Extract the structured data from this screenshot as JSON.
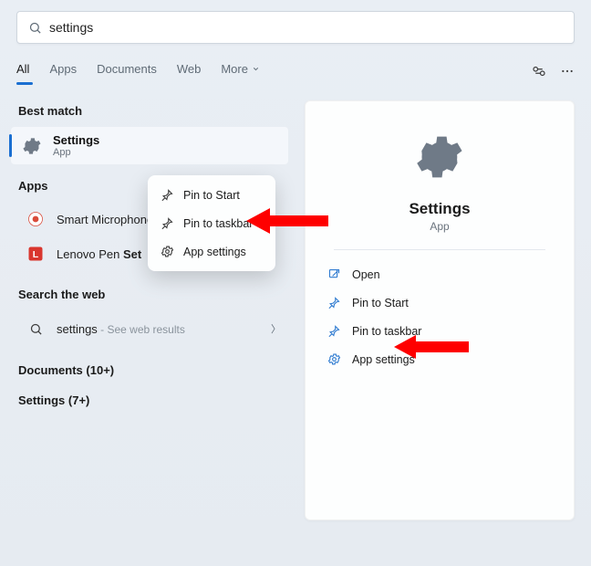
{
  "search": {
    "query": "settings"
  },
  "tabs": {
    "all": "All",
    "apps": "Apps",
    "documents": "Documents",
    "web": "Web",
    "more": "More"
  },
  "sections": {
    "best_match": "Best match",
    "apps": "Apps",
    "search_web": "Search the web",
    "documents_count": "Documents (10+)",
    "settings_count": "Settings (7+)"
  },
  "best_match": {
    "name": "Settings",
    "type": "App"
  },
  "apps_results": {
    "item1": "Smart Microphone",
    "item2_prefix": "Lenovo Pen ",
    "item2_bold": "Set"
  },
  "web_result": {
    "term": "settings",
    "hint": " - See web results"
  },
  "context_menu": {
    "pin_start": "Pin to Start",
    "pin_taskbar": "Pin to taskbar",
    "app_settings": "App settings"
  },
  "detail": {
    "title": "Settings",
    "sub": "App"
  },
  "actions": {
    "open": "Open",
    "pin_start": "Pin to Start",
    "pin_taskbar": "Pin to taskbar",
    "app_settings": "App settings"
  }
}
